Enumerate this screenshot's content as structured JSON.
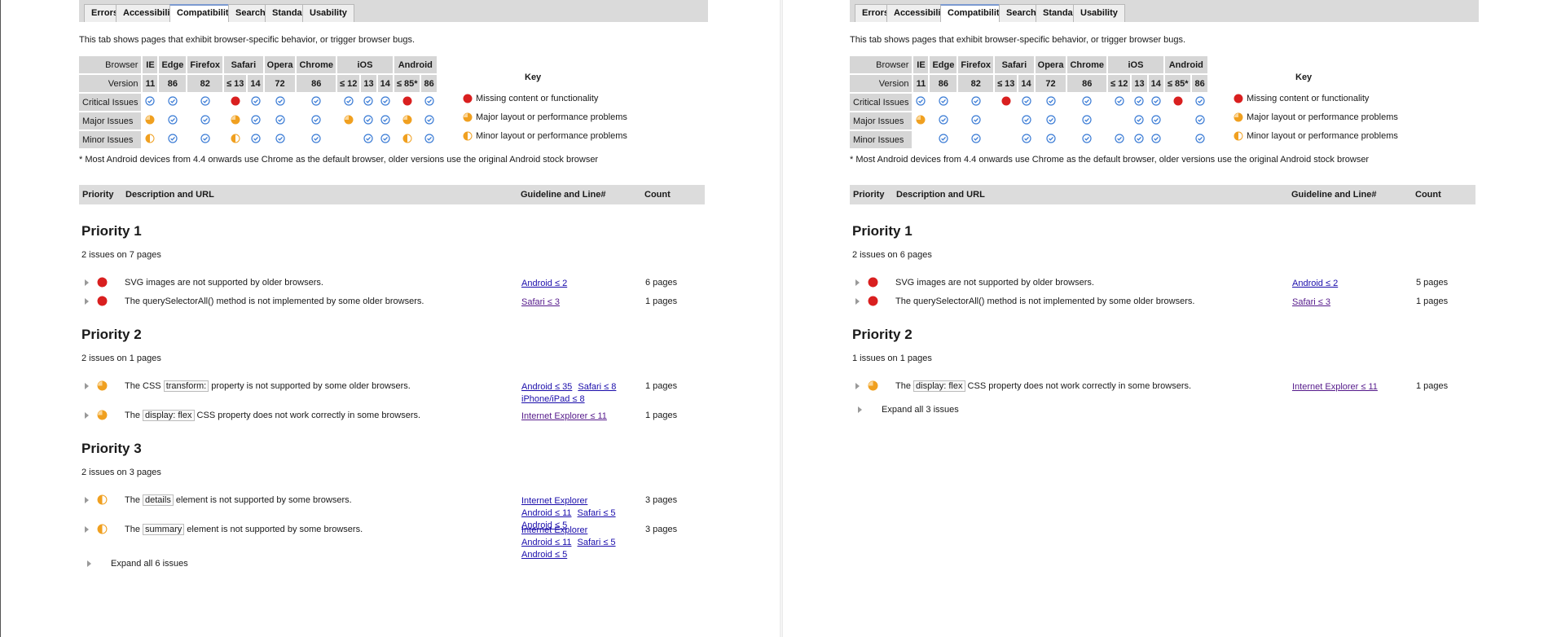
{
  "colors": {
    "critical": "#d91f1f",
    "major": "#f0a020",
    "minor": "#f0a020",
    "ok": "#3a7bd5",
    "header_bg": "#d6d6d6",
    "link": "#1a0dab",
    "visited": "#551a8b"
  },
  "icons": {
    "ok": "check-circle-icon",
    "critical": "red-dot-icon",
    "major": "three-quarter-pie-icon",
    "minor": "half-pie-icon"
  },
  "tabs": [
    "Errors",
    "Accessibility",
    "Compatibility",
    "Search",
    "Standards",
    "Usability"
  ],
  "active_tab": "Compatibility",
  "intro": "This tab shows pages that exhibit browser-specific behavior, or trigger browser bugs.",
  "table": {
    "browser_label": "Browser",
    "version_label": "Version",
    "browsers": [
      {
        "name": "IE",
        "versions": [
          "11"
        ]
      },
      {
        "name": "Edge",
        "versions": [
          "86"
        ]
      },
      {
        "name": "Firefox",
        "versions": [
          "82"
        ]
      },
      {
        "name": "Safari",
        "versions": [
          "≤ 13",
          "14"
        ]
      },
      {
        "name": "Opera",
        "versions": [
          "72"
        ]
      },
      {
        "name": "Chrome",
        "versions": [
          "86"
        ]
      },
      {
        "name": "iOS",
        "versions": [
          "≤ 12",
          "13",
          "14"
        ]
      },
      {
        "name": "Android",
        "versions": [
          "≤ 85*",
          "86"
        ]
      }
    ],
    "row_labels": [
      "Critical Issues",
      "Major Issues",
      "Minor Issues"
    ]
  },
  "key": {
    "title": "Key",
    "items": [
      {
        "icon": "critical",
        "label": "Missing content or functionality"
      },
      {
        "icon": "major",
        "label": "Major layout or performance problems"
      },
      {
        "icon": "minor",
        "label": "Minor layout or performance problems"
      }
    ]
  },
  "footnote": "* Most Android devices from 4.4 onwards use Chrome as the default browser, older versions use the original Android stock browser",
  "results_head": {
    "priority": "Priority",
    "description": "Description and URL",
    "guideline": "Guideline and Line#",
    "count": "Count"
  },
  "panels": [
    {
      "matrix": [
        [
          "ok",
          "ok",
          "ok",
          "critical",
          "ok",
          "ok",
          "ok",
          "ok",
          "ok",
          "ok",
          "critical",
          "ok"
        ],
        [
          "major",
          "ok",
          "ok",
          "major",
          "ok",
          "ok",
          "ok",
          "major",
          "ok",
          "ok",
          "major",
          "ok"
        ],
        [
          "minor",
          "ok",
          "ok",
          "minor",
          "ok",
          "ok",
          "ok",
          "",
          "ok",
          "ok",
          "minor",
          "ok"
        ]
      ],
      "priorities": [
        {
          "title": "Priority 1",
          "summary": "2 issues on 7 pages",
          "issues": [
            {
              "severity": "critical",
              "parts": [
                "SVG images are not supported by older browsers."
              ],
              "guides": [
                {
                  "text": "Android ≤ 2",
                  "visited": false
                }
              ],
              "count": "6 pages"
            },
            {
              "severity": "critical",
              "parts": [
                "The querySelectorAll() method is not implemented by some older browsers."
              ],
              "guides": [
                {
                  "text": "Safari ≤ 3",
                  "visited": true
                }
              ],
              "count": "1 pages"
            }
          ]
        },
        {
          "title": "Priority 2",
          "summary": "2 issues on 1 pages",
          "issues": [
            {
              "severity": "major",
              "parts": [
                "The CSS ",
                "transform:",
                " property is not supported by some older browsers."
              ],
              "guides": [
                {
                  "text": "Android ≤ 35",
                  "visited": false
                },
                {
                  "text": "Safari ≤ 8",
                  "visited": false
                },
                {
                  "text": "iPhone/iPad ≤ 8",
                  "visited": false
                }
              ],
              "count": "1 pages"
            },
            {
              "severity": "major",
              "parts": [
                "The ",
                "display: flex",
                " CSS property does not work correctly in some browsers."
              ],
              "guides": [
                {
                  "text": "Internet Explorer ≤ 11",
                  "visited": true
                }
              ],
              "count": "1 pages"
            }
          ]
        },
        {
          "title": "Priority 3",
          "summary": "2 issues on 3 pages",
          "issues": [
            {
              "severity": "minor",
              "parts": [
                "The ",
                "details",
                " element is not supported by some browsers."
              ],
              "guides": [
                {
                  "text": "Internet Explorer",
                  "visited": false
                },
                {
                  "text": "Android ≤ 11",
                  "visited": false
                },
                {
                  "text": "Safari ≤ 5",
                  "visited": false
                },
                {
                  "text": "Android ≤ 5",
                  "visited": false
                }
              ],
              "count": "3 pages"
            },
            {
              "severity": "minor",
              "parts": [
                "The ",
                "summary",
                " element is not supported by some browsers."
              ],
              "guides": [
                {
                  "text": "Internet Explorer",
                  "visited": false
                },
                {
                  "text": "Android ≤ 11",
                  "visited": false
                },
                {
                  "text": "Safari ≤ 5",
                  "visited": false
                },
                {
                  "text": "Android ≤ 5",
                  "visited": false
                }
              ],
              "count": "3 pages"
            }
          ]
        }
      ],
      "expand_label": "Expand all 6 issues"
    },
    {
      "matrix": [
        [
          "ok",
          "ok",
          "ok",
          "critical",
          "ok",
          "ok",
          "ok",
          "ok",
          "ok",
          "ok",
          "critical",
          "ok"
        ],
        [
          "major",
          "ok",
          "ok",
          "",
          "ok",
          "ok",
          "ok",
          "",
          "ok",
          "ok",
          "",
          "ok"
        ],
        [
          "",
          "ok",
          "ok",
          "",
          "ok",
          "ok",
          "ok",
          "ok",
          "ok",
          "ok",
          "",
          "ok"
        ]
      ],
      "priorities": [
        {
          "title": "Priority 1",
          "summary": "2 issues on 6 pages",
          "issues": [
            {
              "severity": "critical",
              "parts": [
                "SVG images are not supported by older browsers."
              ],
              "guides": [
                {
                  "text": "Android ≤ 2",
                  "visited": false
                }
              ],
              "count": "5 pages"
            },
            {
              "severity": "critical",
              "parts": [
                "The querySelectorAll() method is not implemented by some older browsers."
              ],
              "guides": [
                {
                  "text": "Safari ≤ 3",
                  "visited": true
                }
              ],
              "count": "1 pages"
            }
          ]
        },
        {
          "title": "Priority 2",
          "summary": "1 issues on 1 pages",
          "issues": [
            {
              "severity": "major",
              "parts": [
                "The ",
                "display: flex",
                " CSS property does not work correctly in some browsers."
              ],
              "guides": [
                {
                  "text": "Internet Explorer ≤ 11",
                  "visited": true
                }
              ],
              "count": "1 pages"
            }
          ]
        }
      ],
      "expand_label": "Expand all 3 issues"
    }
  ]
}
